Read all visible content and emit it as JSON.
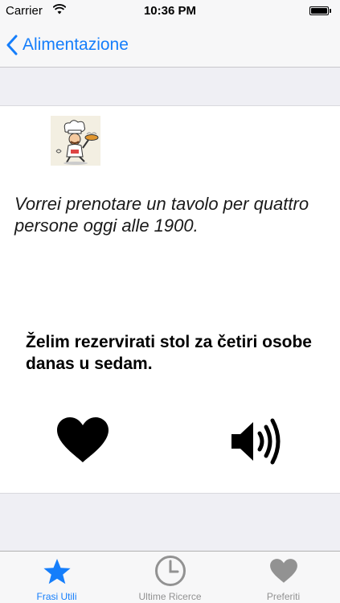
{
  "status_bar": {
    "carrier": "Carrier",
    "time": "10:36 PM"
  },
  "nav": {
    "back_label": "Alimentazione"
  },
  "phrase": {
    "italian": "Vorrei prenotare un tavolo per quattro persone oggi alle 1900.",
    "croatian": "Želim rezervirati stol za četiri osobe danas u sedam."
  },
  "tabs": [
    {
      "label": "Frasi Utili",
      "icon": "star-icon",
      "active": true
    },
    {
      "label": "Ultime Ricerce",
      "icon": "clock-icon",
      "active": false
    },
    {
      "label": "Preferiti",
      "icon": "heart-icon",
      "active": false
    }
  ],
  "colors": {
    "accent": "#157efb",
    "inactive": "#929292",
    "background": "#efeff4"
  }
}
